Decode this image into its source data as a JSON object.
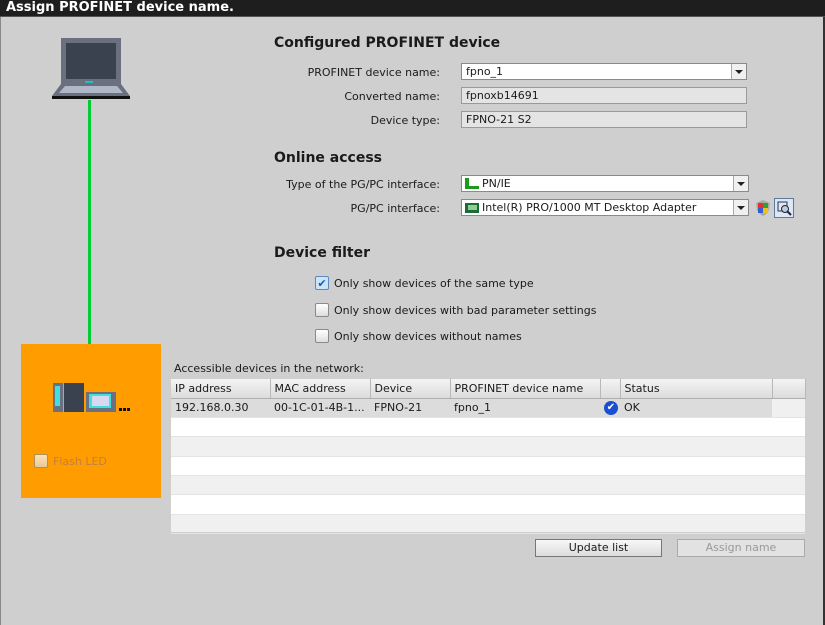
{
  "title": "Assign PROFINET device name.",
  "configured": {
    "heading": "Configured PROFINET device",
    "name_label": "PROFINET device name:",
    "name_value": "fpno_1",
    "converted_label": "Converted name:",
    "converted_value": "fpnoxb14691",
    "type_label": "Device type:",
    "type_value": "FPNO-21 S2"
  },
  "online": {
    "heading": "Online access",
    "iface_type_label": "Type of the PG/PC interface:",
    "iface_type_value": "PN/IE",
    "iface_label": "PG/PC interface:",
    "iface_value": "Intel(R) PRO/1000 MT Desktop Adapter"
  },
  "filter": {
    "heading": "Device filter",
    "options": [
      {
        "label": "Only show devices of the same type",
        "checked": true
      },
      {
        "label": "Only show devices with bad parameter settings",
        "checked": false
      },
      {
        "label": "Only show devices without names",
        "checked": false
      }
    ]
  },
  "flash_led": "Flash LED",
  "devices": {
    "caption": "Accessible devices in the network:",
    "columns": [
      "IP address",
      "MAC address",
      "Device",
      "PROFINET device name",
      "",
      "Status"
    ],
    "rows": [
      {
        "ip": "192.168.0.30",
        "mac": "00-1C-01-4B-1...",
        "device": "FPNO-21",
        "name": "fpno_1",
        "status": "OK"
      }
    ]
  },
  "buttons": {
    "update": "Update list",
    "assign": "Assign name"
  },
  "colors": {
    "panel": "#ff9c00",
    "link": "#00cc33"
  }
}
